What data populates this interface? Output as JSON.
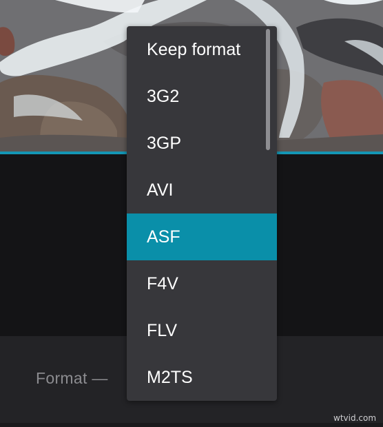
{
  "format_field": {
    "label": "Format —"
  },
  "dropdown": {
    "options": [
      "Keep format",
      "3G2",
      "3GP",
      "AVI",
      "ASF",
      "F4V",
      "FLV",
      "M2TS"
    ],
    "selected": "ASF"
  },
  "watermark": "wtvid.com",
  "colors": {
    "accent": "#0a8fa9",
    "timeline": "#1496b4",
    "dropdown_bg": "#37373b",
    "panel_bg": "#232326",
    "page_bg": "#141416"
  }
}
